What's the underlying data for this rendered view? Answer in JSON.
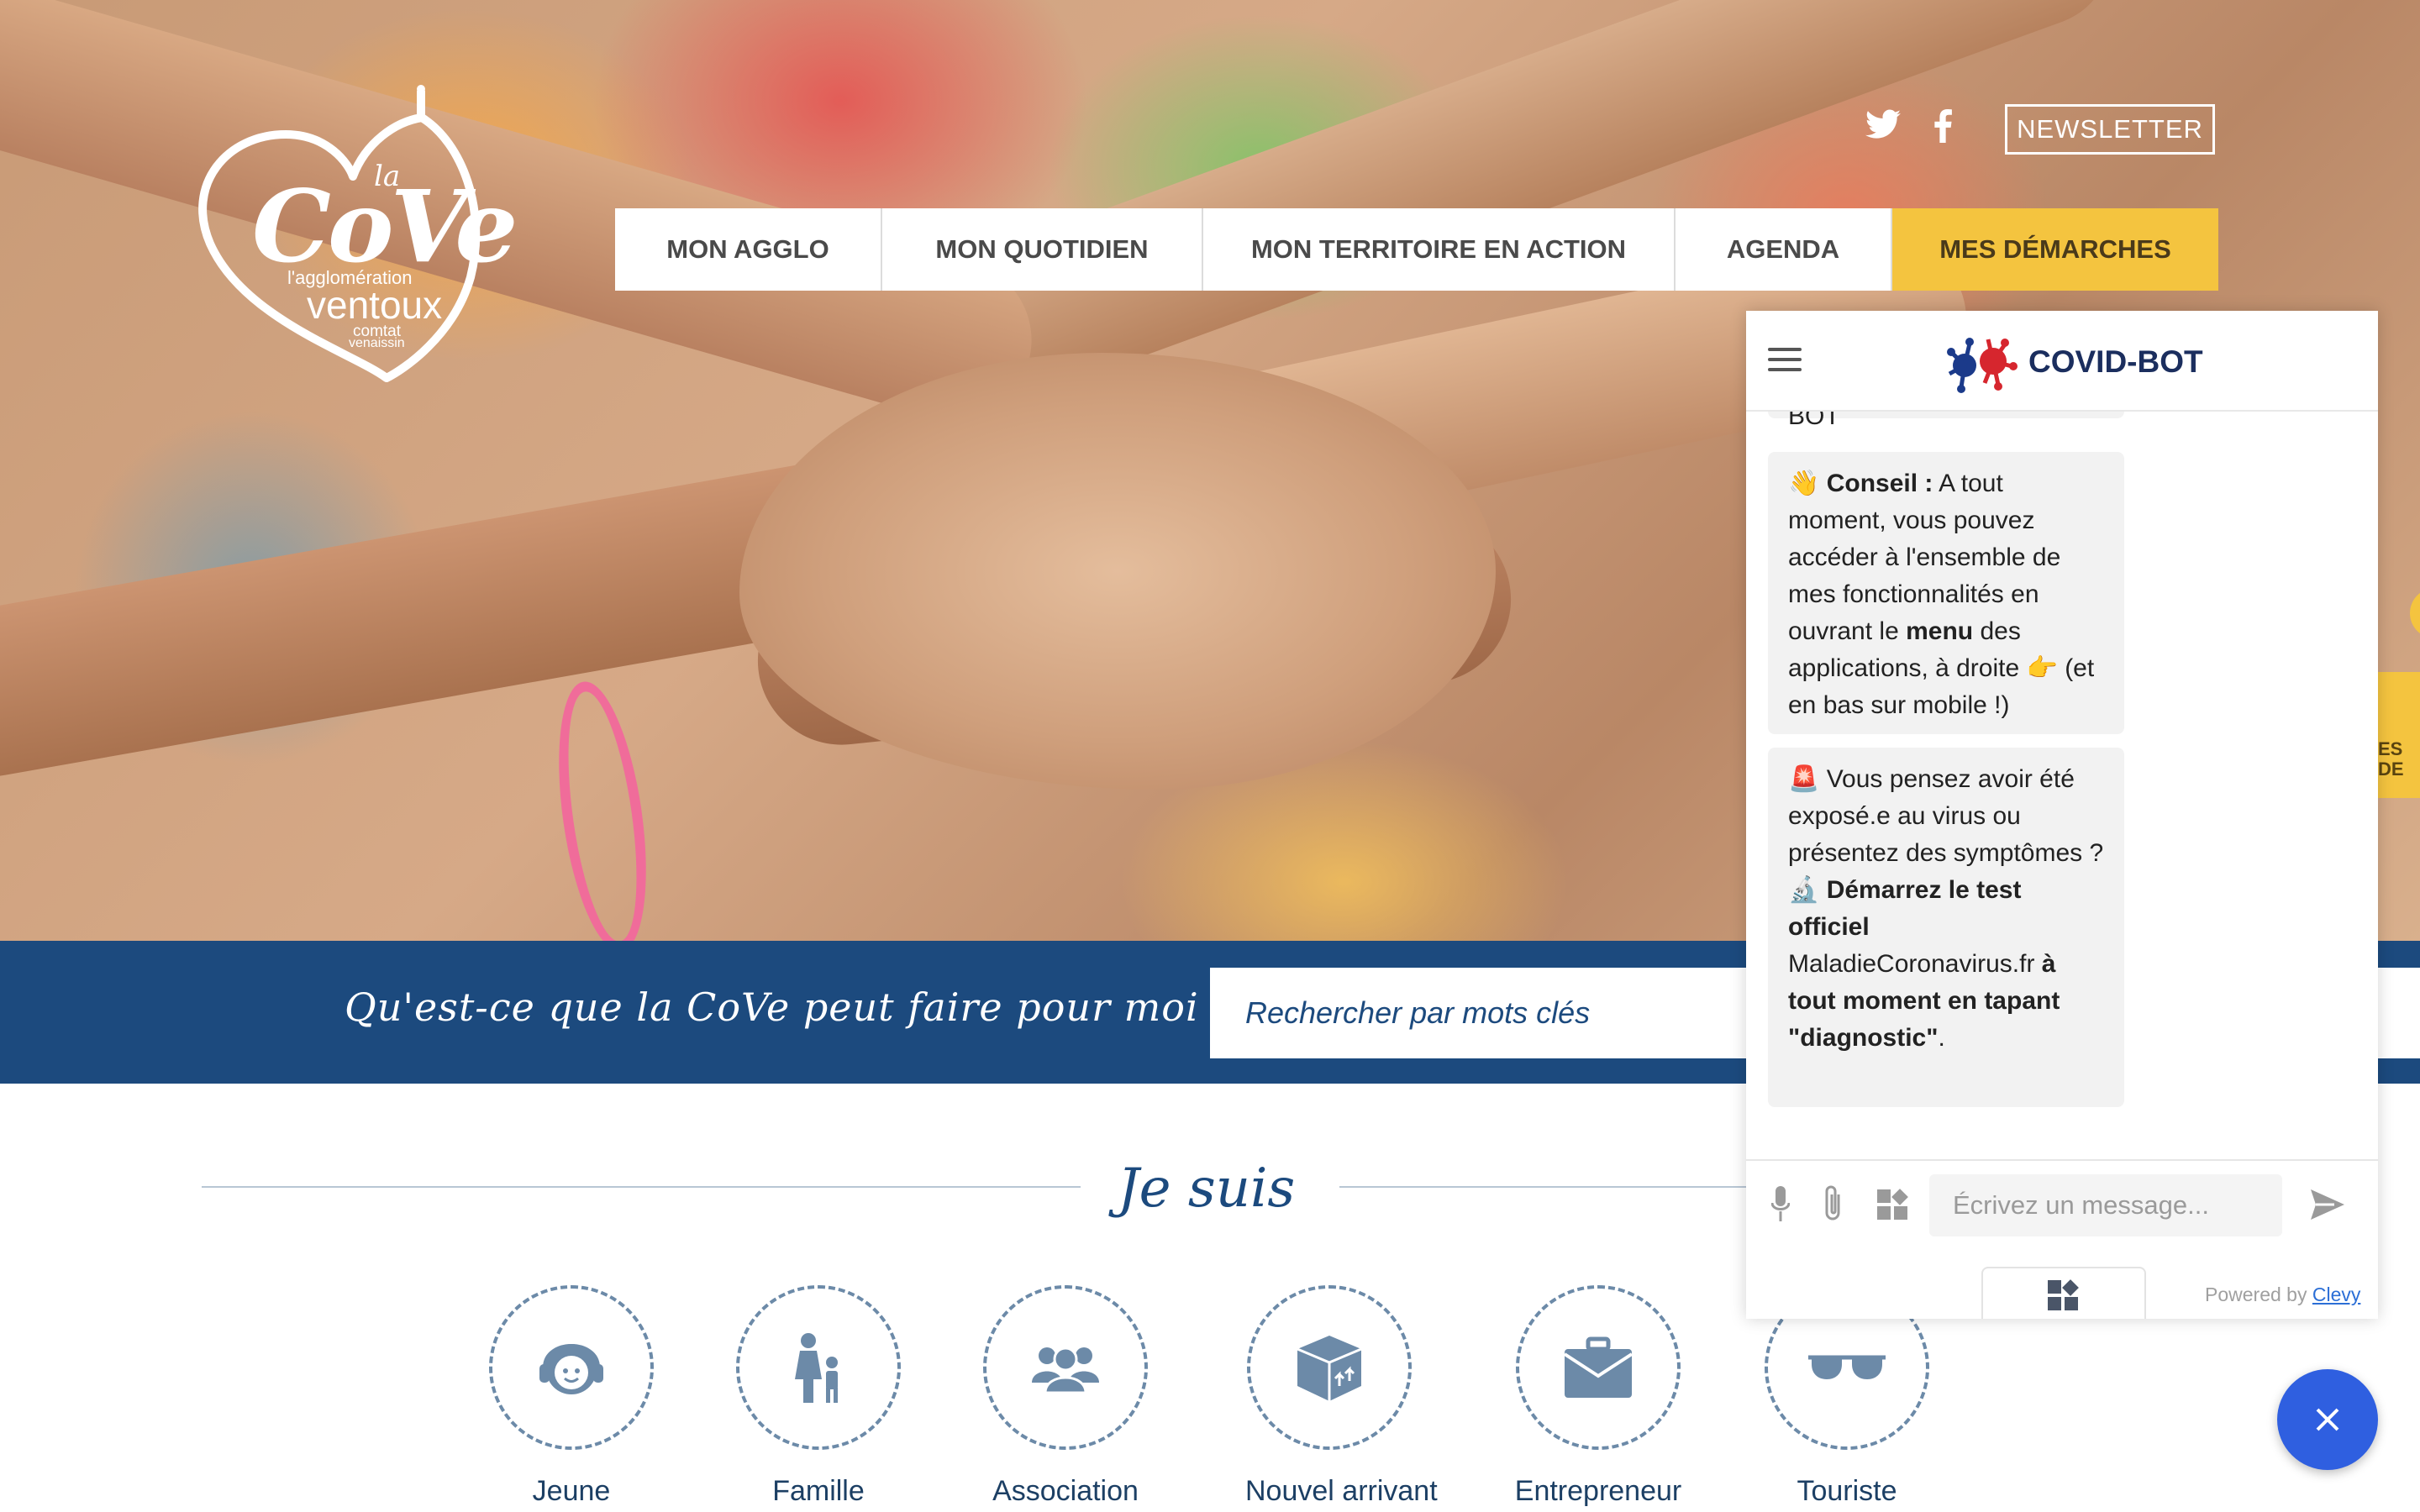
{
  "logo": {
    "la": "la",
    "name": "CoVe",
    "line1": "l'agglomération",
    "line2": "ventoux",
    "line3": "comtat",
    "line4": "venaissin"
  },
  "header": {
    "twitter_icon": "twitter-icon",
    "facebook_icon": "facebook-icon",
    "newsletter_label": "NEWSLETTER"
  },
  "nav": {
    "items": [
      {
        "label": "MON AGGLO"
      },
      {
        "label": "MON QUOTIDIEN"
      },
      {
        "label": "MON TERRITOIRE EN ACTION"
      },
      {
        "label": "AGENDA"
      },
      {
        "label": "MES DÉMARCHES",
        "highlight_color": "#f4c43f"
      }
    ]
  },
  "search": {
    "question": "Qu'est-ce que la CoVe peut faire pour moi ?",
    "placeholder": "Rechercher par mots clés"
  },
  "je_suis": {
    "title": "Je suis",
    "categories": [
      {
        "label": "Jeune",
        "icon": "child-face-icon"
      },
      {
        "label": "Famille",
        "icon": "family-icon"
      },
      {
        "label": "Association",
        "icon": "group-icon"
      },
      {
        "label": "Nouvel arrivant",
        "icon": "moving-box-icon"
      },
      {
        "label": "Entrepreneur",
        "icon": "briefcase-icon"
      },
      {
        "label": "Touriste",
        "icon": "sunglasses-icon"
      }
    ]
  },
  "chat": {
    "title": "COVID-BOT",
    "truncated_text": "BOT",
    "msg1": {
      "emoji": "👋",
      "bold1": "Conseil :",
      "t1": " A tout moment, vous pouvez accéder à l'ensemble de mes fonctionnalités en ouvrant le ",
      "bold2": "menu",
      "t2": " des applications, à droite 👉 (et en bas sur mobile !)"
    },
    "msg2": {
      "emoji1": "🚨",
      "t1": " Vous pensez avoir été exposé.e au virus ou présentez des symptômes ?",
      "emoji2": "🔬",
      "bold1": " Démarrez le test officiel",
      "t2": " MaladieCoronavirus.fr ",
      "bold2": "à tout moment en tapant \"diagnostic\"",
      "t3": "."
    },
    "input_placeholder": "Écrivez un message...",
    "powered_by": "Powered by",
    "powered_link": "Clevy"
  },
  "side_tab": {
    "line1": "ES",
    "line2": "DE"
  },
  "colors": {
    "brand_blue": "#1c4a7e",
    "accent_yellow": "#f4c43f",
    "chat_close": "#2f5fe0"
  }
}
